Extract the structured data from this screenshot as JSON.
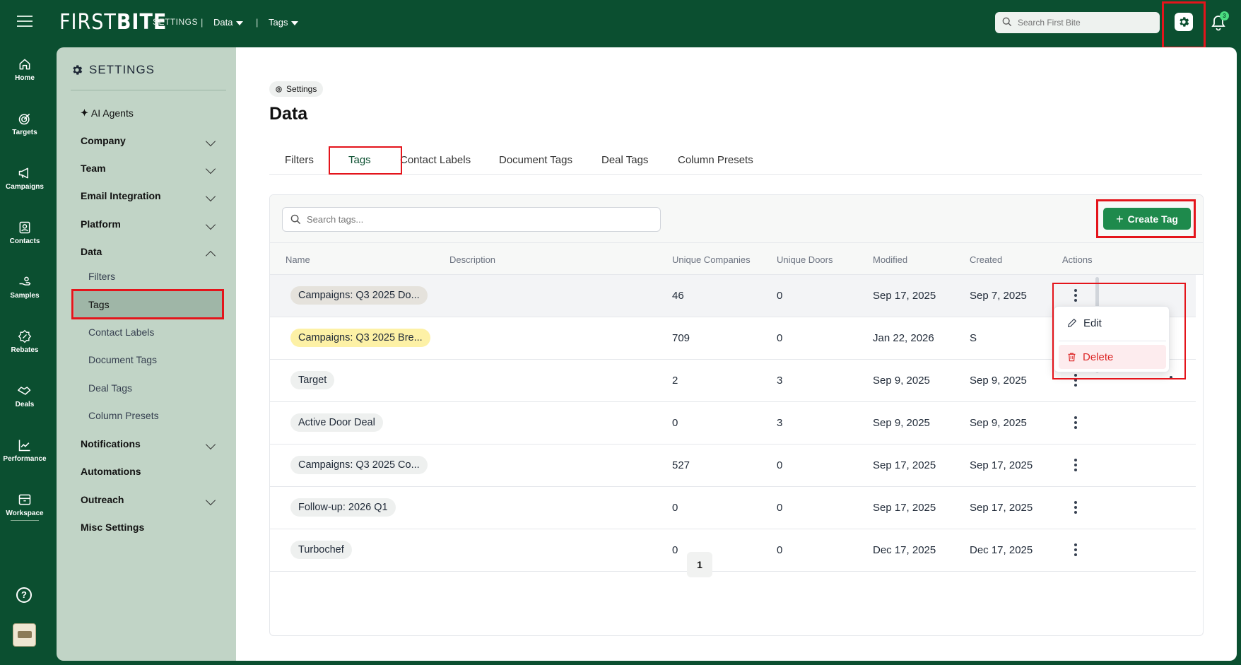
{
  "topbar": {
    "logo_a": "FIRST",
    "logo_b": "BITE",
    "settings": "SETTINGS",
    "sep": "|",
    "crumb_data": "Data",
    "crumb_tags": "Tags",
    "search_placeholder": "Search First Bite",
    "bell_badge": "3"
  },
  "rail": {
    "items": [
      {
        "label": "Home",
        "icon": "home-icon"
      },
      {
        "label": "Targets",
        "icon": "target-icon"
      },
      {
        "label": "Campaigns",
        "icon": "megaphone-icon"
      },
      {
        "label": "Contacts",
        "icon": "contact-card-icon"
      },
      {
        "label": "Samples",
        "icon": "hand-icon"
      },
      {
        "label": "Rebates",
        "icon": "percent-badge-icon"
      },
      {
        "label": "Deals",
        "icon": "handshake-icon"
      },
      {
        "label": "Performance",
        "icon": "chart-line-icon"
      },
      {
        "label": "Workspace",
        "icon": "archive-icon"
      }
    ],
    "help": "?"
  },
  "sidebar": {
    "title": "SETTINGS",
    "ai_agents": "AI Agents",
    "company": "Company",
    "team": "Team",
    "email": "Email Integration",
    "platform": "Platform",
    "data": "Data",
    "data_children": {
      "filters": "Filters",
      "tags": "Tags",
      "contact_labels": "Contact Labels",
      "document_tags": "Document Tags",
      "deal_tags": "Deal Tags",
      "column_presets": "Column Presets"
    },
    "notifications": "Notifications",
    "automations": "Automations",
    "outreach": "Outreach",
    "misc": "Misc Settings"
  },
  "main": {
    "breadcrumb": "Settings",
    "title": "Data",
    "tabs": {
      "filters": "Filters",
      "tags": "Tags",
      "contact_labels": "Contact Labels",
      "document_tags": "Document Tags",
      "deal_tags": "Deal Tags",
      "column_presets": "Column Presets"
    },
    "search_placeholder": "Search tags...",
    "create_button": "Create Tag",
    "columns": {
      "name": "Name",
      "description": "Description",
      "companies": "Unique Companies",
      "doors": "Unique Doors",
      "modified": "Modified",
      "created": "Created",
      "actions": "Actions"
    },
    "rows": [
      {
        "name": "Campaigns: Q3 2025 Do...",
        "companies": "46",
        "doors": "0",
        "modified": "Sep 17, 2025",
        "created": "Sep 7, 2025",
        "chip_color": "#e5e2dc"
      },
      {
        "name": "Campaigns: Q3 2025 Bre...",
        "companies": "709",
        "doors": "0",
        "modified": "Jan 22, 2026",
        "created": "S",
        "chip_color": "#fdf1a6"
      },
      {
        "name": "Target",
        "companies": "2",
        "doors": "3",
        "modified": "Sep 9, 2025",
        "created": "Sep 9, 2025",
        "chip_color": "#eef0ef"
      },
      {
        "name": "Active Door Deal",
        "companies": "0",
        "doors": "3",
        "modified": "Sep 9, 2025",
        "created": "Sep 9, 2025",
        "chip_color": "#eef0ef"
      },
      {
        "name": "Campaigns: Q3 2025 Co...",
        "companies": "527",
        "doors": "0",
        "modified": "Sep 17, 2025",
        "created": "Sep 17, 2025",
        "chip_color": "#eef0ef"
      },
      {
        "name": "Follow-up: 2026 Q1",
        "companies": "0",
        "doors": "0",
        "modified": "Sep 17, 2025",
        "created": "Sep 17, 2025",
        "chip_color": "#eef0ef"
      },
      {
        "name": "Turbochef",
        "companies": "0",
        "doors": "0",
        "modified": "Dec 17, 2025",
        "created": "Dec 17, 2025",
        "chip_color": "#eef0ef"
      }
    ],
    "menu": {
      "edit": "Edit",
      "delete": "Delete"
    },
    "page": "1"
  }
}
